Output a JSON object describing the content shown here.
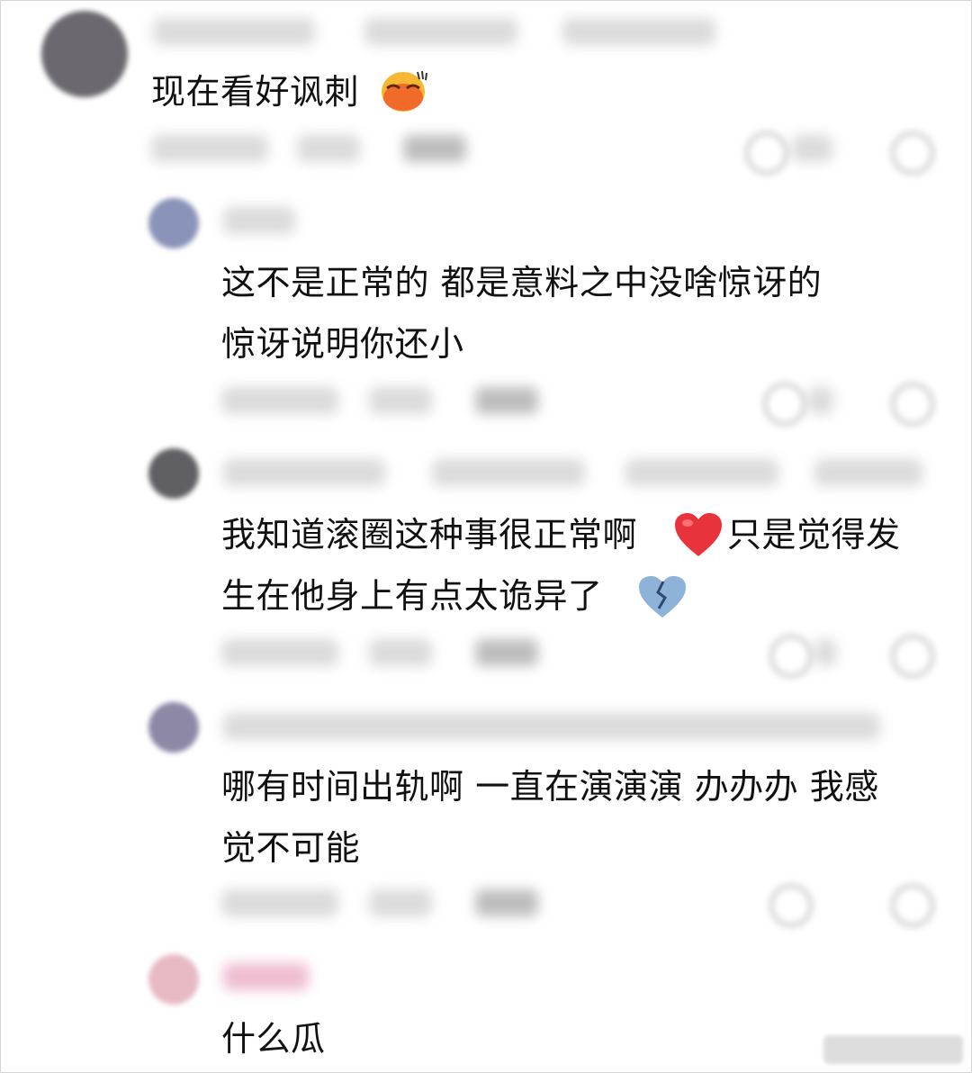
{
  "comments": [
    {
      "text": "现在看好讽刺",
      "emoji": "smirk-face-emoji"
    },
    {
      "lines": [
        "这不是正常的 都是意料之中没啥惊讶的",
        "惊讶说明你还小"
      ]
    },
    {
      "lines": [
        "我知道滚圈这种事很正常啊",
        "只是觉得发",
        "生在他身上有点太诡异了"
      ],
      "emoji1": "red-heart-emoji",
      "emoji2": "broken-heart-emoji"
    },
    {
      "lines": [
        "哪有时间出轨啊 一直在演演演 办办办 我感",
        "觉不可能"
      ]
    },
    {
      "text": "什么瓜"
    }
  ],
  "colors": {
    "heart": "#e8323c",
    "broken_heart": "#8fb2d9",
    "blur_gray": "#cfcfcf"
  }
}
